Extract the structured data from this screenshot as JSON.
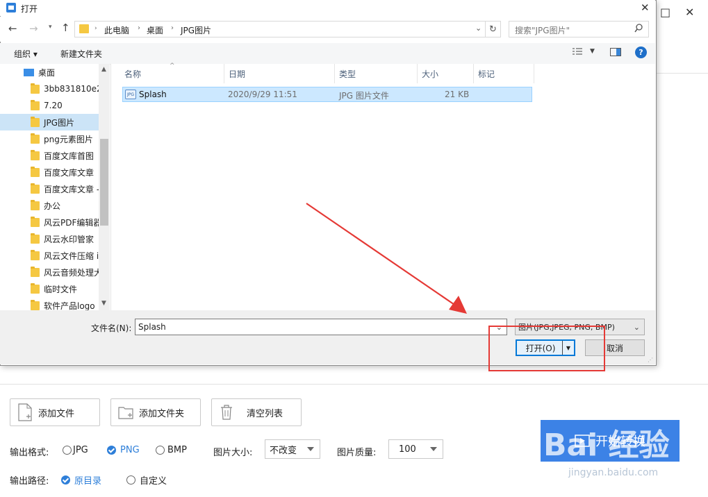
{
  "background_app": {
    "window_controls": [
      "□",
      "✕"
    ],
    "buttons": {
      "add_file": "添加文件",
      "add_folder": "添加文件夹",
      "clear_list": "清空列表"
    },
    "output_format_label": "输出格式:",
    "formats": [
      {
        "label": "JPG",
        "selected": false
      },
      {
        "label": "PNG",
        "selected": true
      },
      {
        "label": "BMP",
        "selected": false
      }
    ],
    "image_size_label": "图片大小:",
    "image_size_value": "不改变",
    "image_quality_label": "图片质量:",
    "image_quality_value": "100",
    "output_path_label": "输出路径:",
    "path_options": [
      {
        "label": "原目录",
        "selected": true
      },
      {
        "label": "自定义",
        "selected": false
      }
    ],
    "start_button": "开始转换",
    "watermark": "Bai 经验",
    "watermark_url": "jingyan.baidu.com"
  },
  "dialog": {
    "title": "打开",
    "close_glyph": "✕",
    "breadcrumb": [
      "此电脑",
      "桌面",
      "JPG图片"
    ],
    "search_placeholder": "搜索\"JPG图片\"",
    "organize": "组织 ▾",
    "new_folder": "新建文件夹",
    "nav_root": "桌面",
    "nav_items": [
      {
        "label": "3bb831810e2",
        "selected": false
      },
      {
        "label": "7.20",
        "selected": false
      },
      {
        "label": "JPG图片",
        "selected": true
      },
      {
        "label": "png元素图片",
        "selected": false
      },
      {
        "label": "百度文库首图",
        "selected": false
      },
      {
        "label": "百度文库文章",
        "selected": false
      },
      {
        "label": "百度文库文章 -",
        "selected": false
      },
      {
        "label": "办公",
        "selected": false
      },
      {
        "label": "风云PDF编辑器",
        "selected": false
      },
      {
        "label": "风云水印管家",
        "selected": false
      },
      {
        "label": "风云文件压缩 i",
        "selected": false
      },
      {
        "label": "风云音频处理大",
        "selected": false
      },
      {
        "label": "临时文件",
        "selected": false
      },
      {
        "label": "软件产品logo",
        "selected": false
      }
    ],
    "columns": [
      "名称",
      "日期",
      "类型",
      "大小",
      "标记"
    ],
    "files": [
      {
        "icon": "JPG",
        "name": "Splash",
        "date": "2020/9/29 11:51",
        "type": "JPG 图片文件",
        "size": "21 KB",
        "tag": ""
      }
    ],
    "filename_label": "文件名(N):",
    "filename_value": "Splash",
    "filetype_value": "图片(JPG,JPEG, PNG, BMP)",
    "open_button": "打开(O)",
    "cancel_button": "取消"
  },
  "colors": {
    "accent": "#2e7fd9",
    "selection": "#cce8ff",
    "annotation_red": "#e53935",
    "start_button": "#3c82e6"
  }
}
